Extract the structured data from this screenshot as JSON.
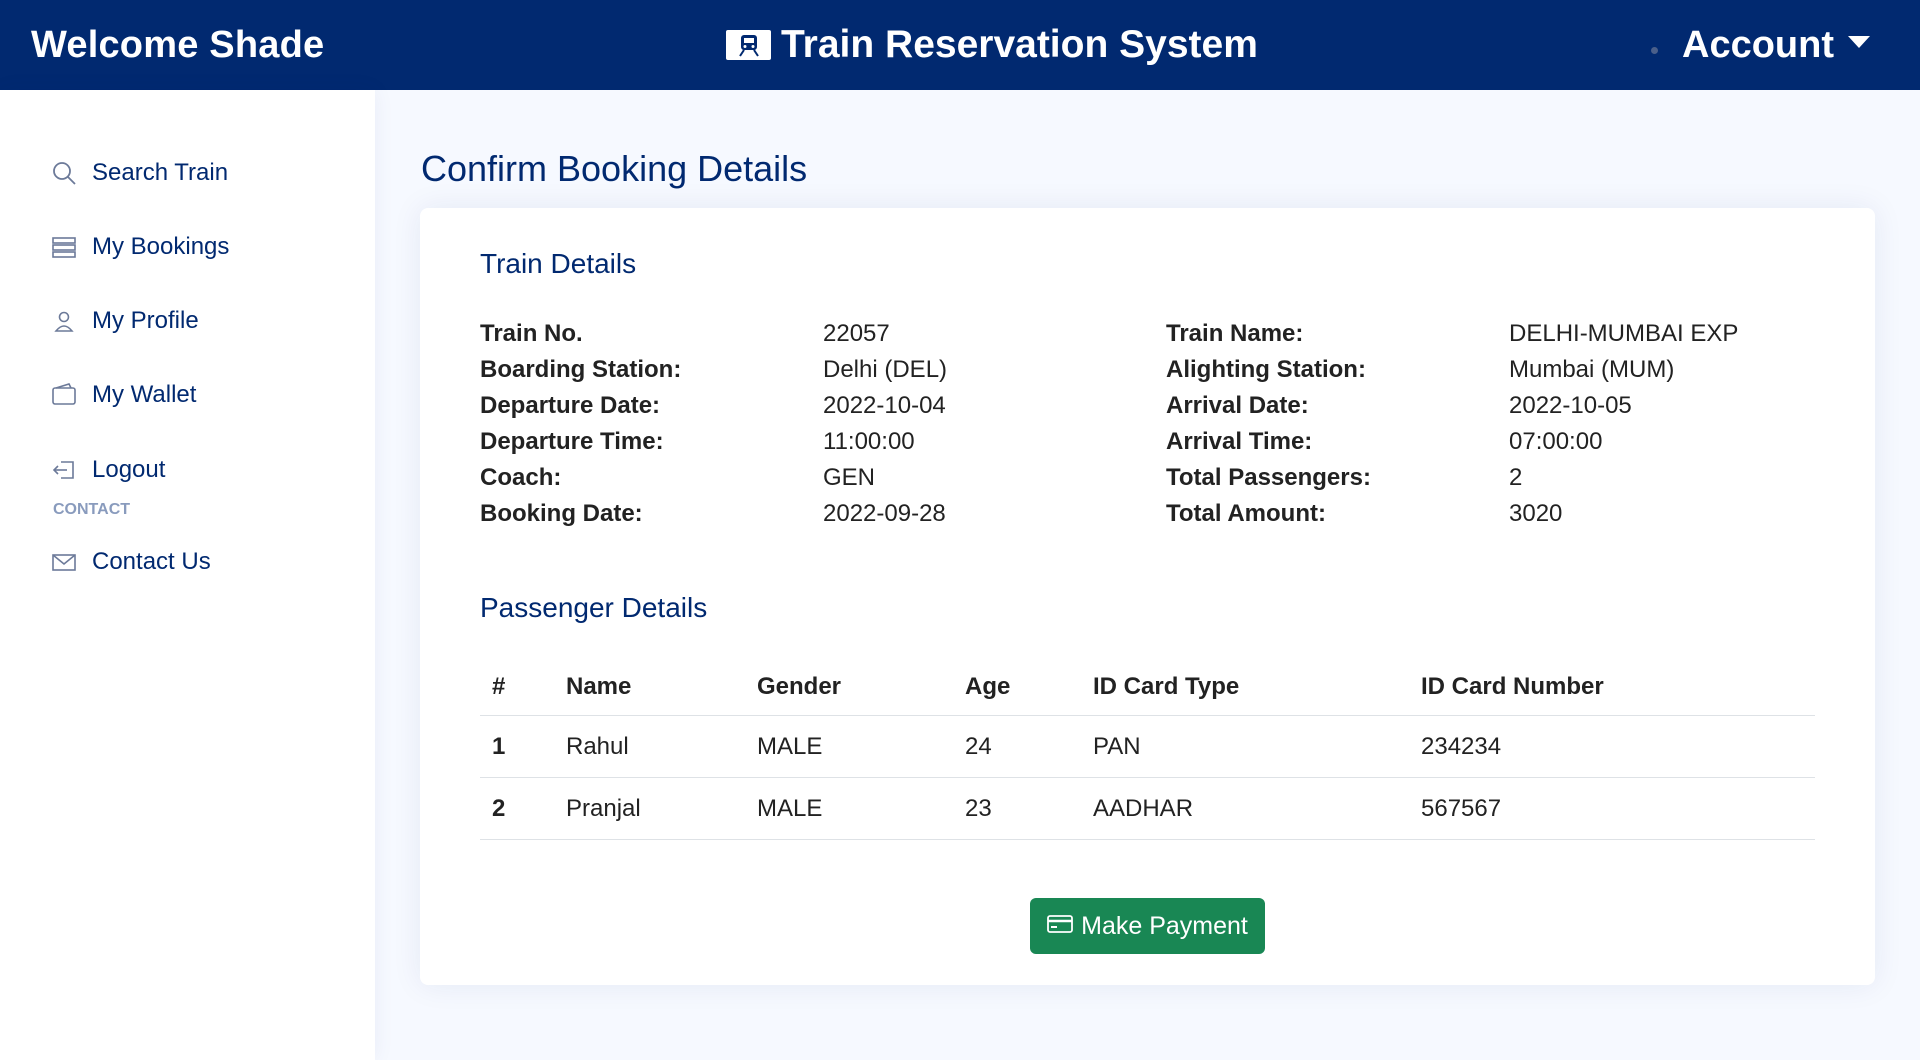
{
  "header": {
    "welcome": "Welcome Shade",
    "title": "Train Reservation System",
    "account_label": "Account",
    "brand_icon": "train-icon"
  },
  "sidebar": {
    "items": [
      {
        "label": "Search Train",
        "icon": "search-icon"
      },
      {
        "label": "My Bookings",
        "icon": "bookings-icon"
      },
      {
        "label": "My Profile",
        "icon": "person-icon"
      },
      {
        "label": "My Wallet",
        "icon": "wallet-icon"
      },
      {
        "label": "Logout",
        "icon": "logout-icon"
      }
    ],
    "section_heading": "CONTACT",
    "contact": {
      "label": "Contact Us",
      "icon": "envelope-icon"
    }
  },
  "main": {
    "page_title": "Confirm Booking Details",
    "train_section_title": "Train Details",
    "train_details": [
      {
        "label": "Train No.",
        "value": "22057"
      },
      {
        "label": "Train Name:",
        "value": "DELHI-MUMBAI EXP"
      },
      {
        "label": "Boarding Station:",
        "value": "Delhi (DEL)"
      },
      {
        "label": "Alighting Station:",
        "value": "Mumbai (MUM)"
      },
      {
        "label": "Departure Date:",
        "value": "2022-10-04"
      },
      {
        "label": "Arrival Date:",
        "value": "2022-10-05"
      },
      {
        "label": "Departure Time:",
        "value": "11:00:00"
      },
      {
        "label": "Arrival Time:",
        "value": "07:00:00"
      },
      {
        "label": "Coach:",
        "value": "GEN"
      },
      {
        "label": "Total Passengers:",
        "value": "2"
      },
      {
        "label": "Booking Date:",
        "value": "2022-09-28"
      },
      {
        "label": "Total Amount:",
        "value": "3020"
      }
    ],
    "passenger_section_title": "Passenger Details",
    "passenger_table": {
      "headers": [
        "#",
        "Name",
        "Gender",
        "Age",
        "ID Card Type",
        "ID Card Number"
      ],
      "rows": [
        [
          "1",
          "Rahul",
          "MALE",
          "24",
          "PAN",
          "234234"
        ],
        [
          "2",
          "Pranjal",
          "MALE",
          "23",
          "AADHAR",
          "567567"
        ]
      ]
    },
    "pay_button": {
      "label": "Make Payment",
      "icon": "credit-card-icon",
      "color": "#198754"
    }
  },
  "colors": {
    "navbar": "#012970",
    "accent_text": "#012970",
    "background": "#f6f9ff"
  }
}
